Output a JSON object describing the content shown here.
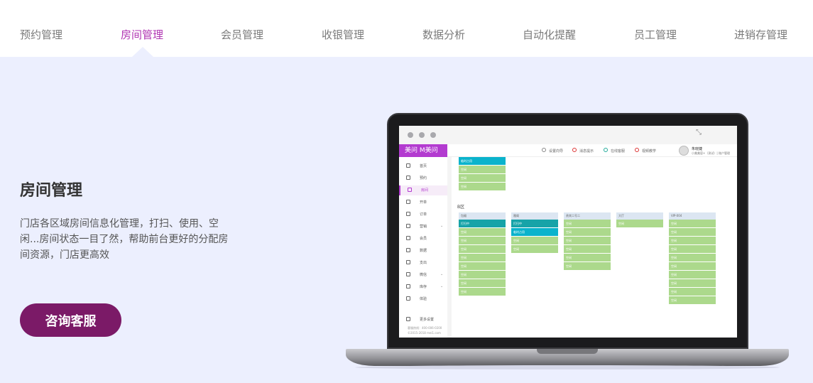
{
  "tabs": [
    {
      "label": "预约管理",
      "active": false
    },
    {
      "label": "房间管理",
      "active": true
    },
    {
      "label": "会员管理",
      "active": false
    },
    {
      "label": "收银管理",
      "active": false
    },
    {
      "label": "数据分析",
      "active": false
    },
    {
      "label": "自动化提醒",
      "active": false
    },
    {
      "label": "员工管理",
      "active": false
    },
    {
      "label": "进销存管理",
      "active": false
    }
  ],
  "feature": {
    "title": "房间管理",
    "description": "门店各区域房间信息化管理，打扫、使用、空闲...房间状态一目了然，帮助前台更好的分配房间资源，门店更高效",
    "cta_label": "咨询客服"
  },
  "colors": {
    "accent": "#b136b3",
    "cta": "#7b1a67",
    "panel": "#eceffe",
    "room_free": "#acd98c",
    "room_busy": "#17a3a8"
  },
  "screen": {
    "logo": "美问 M美问",
    "nav": [
      {
        "label": "首页",
        "icon": "home-icon",
        "active": false
      },
      {
        "label": "预约",
        "icon": "clock-icon",
        "active": false
      },
      {
        "label": "房间",
        "icon": "room-icon",
        "active": true
      },
      {
        "label": "开单",
        "icon": "order-icon",
        "active": false
      },
      {
        "label": "订单",
        "icon": "list-icon",
        "active": false
      },
      {
        "label": "营销",
        "icon": "gift-icon",
        "active": false,
        "has_chevron": true
      },
      {
        "label": "会员",
        "icon": "users-icon",
        "active": false
      },
      {
        "label": "数据",
        "icon": "chart-icon",
        "active": false
      },
      {
        "label": "支出",
        "icon": "receipt-icon",
        "active": false
      },
      {
        "label": "微信",
        "icon": "wechat-icon",
        "active": false,
        "has_chevron": true
      },
      {
        "label": "库存",
        "icon": "box-icon",
        "active": false,
        "has_chevron": true
      },
      {
        "label": "体验",
        "icon": "pin-icon",
        "active": false
      }
    ],
    "more_settings": "更多设置",
    "footer_line1": "客服热线：400-006-0200",
    "footer_line2": "©2015-2018 mei1.com",
    "topbar": [
      {
        "label": "设置向导",
        "icon": "gear-icon"
      },
      {
        "label": "消息提示",
        "icon": "bell-icon"
      },
      {
        "label": "在线客服",
        "icon": "service-icon"
      },
      {
        "label": "视频教学",
        "icon": "play-icon"
      }
    ],
    "user_name": "朱晓婕",
    "shop_name": "小美美容+（测试）| 账户管理",
    "top_cells": [
      "临时占用",
      "空闲",
      "空闲",
      "空闲"
    ],
    "zone_label": "B区",
    "rooms": [
      {
        "name": "包厢",
        "cells": [
          "打扫中",
          "空闲",
          "空闲",
          "空闲",
          "空闲",
          "空闲",
          "空闲",
          "空闲",
          "空闲"
        ]
      },
      {
        "name": "雅阁",
        "cells": [
          "打扫中",
          "临时占用",
          "空闲",
          "空闲"
        ]
      },
      {
        "name": "贵宾二号二",
        "cells": [
          "空闲",
          "空闲",
          "空闲",
          "空闲",
          "空闲",
          "空闲"
        ]
      },
      {
        "name": "大厅",
        "cells": [
          "空闲"
        ]
      },
      {
        "name": "VIP-004",
        "cells": [
          "空闲",
          "空闲",
          "空闲",
          "空闲",
          "空闲",
          "空闲",
          "空闲",
          "空闲",
          "空闲",
          "空闲"
        ]
      }
    ]
  }
}
